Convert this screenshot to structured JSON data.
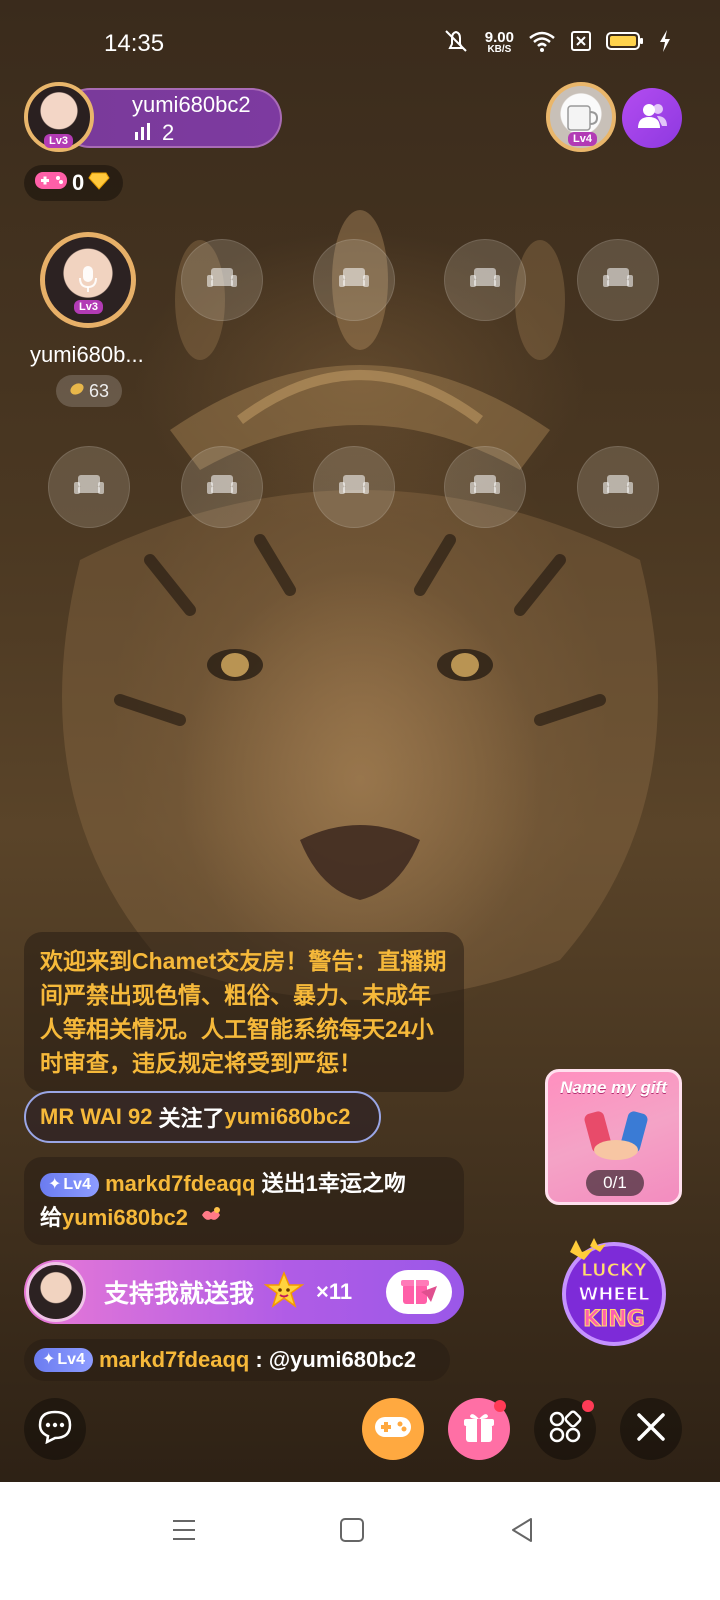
{
  "status_bar": {
    "time": "14:35",
    "net_speed_value": "9.00",
    "net_speed_unit": "KB/S",
    "icons": [
      "mute-icon",
      "wifi-icon",
      "sim-off-icon",
      "battery-icon",
      "charging-icon"
    ]
  },
  "host": {
    "name": "yumi680bc2",
    "viewer_count": "2",
    "level": "Lv3"
  },
  "wallet": {
    "game_coins": "0"
  },
  "top_right": {
    "viewer_level": "Lv4"
  },
  "seats": {
    "host_seat": {
      "name": "yumi680b...",
      "level": "Lv3",
      "coins": "63"
    },
    "empty_count": 9
  },
  "chat": {
    "notice": "欢迎来到Chamet交友房！警告：直播期间严禁出现色情、粗俗、暴力、未成年人等相关情况。人工智能系统每天24小时审查，违反规定将受到严惩！",
    "follow": {
      "user": "MR WAI 92",
      "action": "关注了",
      "target": "yumi680bc2"
    },
    "gift": {
      "level": "Lv4",
      "user": "markd7fdeaqq",
      "action": "送出1幸运之吻",
      "prefix": "给",
      "target": "yumi680bc2"
    },
    "mention": {
      "level": "Lv4",
      "user": "markd7fdeaqq",
      "separator": ":",
      "text": "@yumi680bc2"
    }
  },
  "support_bar": {
    "text": "支持我就送我",
    "multiplier": "×11"
  },
  "name_gift": {
    "title": "Name my gift",
    "progress": "0/1"
  },
  "lucky_wheel": {
    "line1": "LUCKY",
    "line2": "WHEEL",
    "line3": "KING"
  },
  "colors": {
    "notice_text": "#f6b93a",
    "support_bar_start": "#e879d6",
    "support_bar_end": "#9a58e8",
    "level_badge": "#6b7cf0",
    "gift_button": "#ff6fa5",
    "game_button": "#ffa940"
  }
}
